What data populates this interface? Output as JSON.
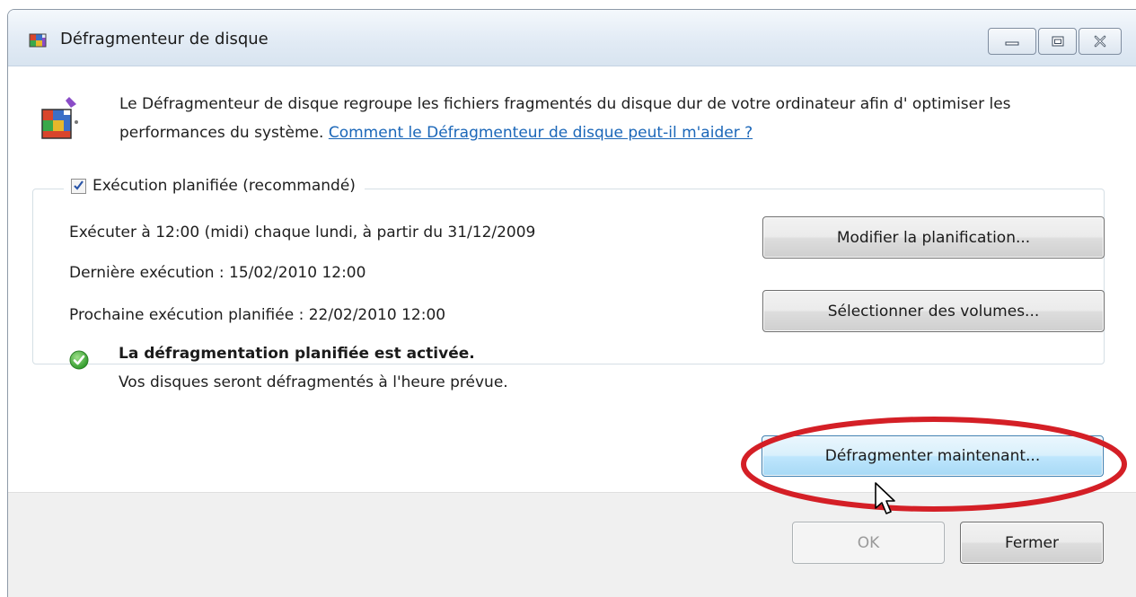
{
  "window": {
    "title": "Défragmenteur de disque",
    "controls": [
      "minimize",
      "maximize",
      "close"
    ]
  },
  "intro": {
    "text": "Le Défragmenteur de disque regroupe les fichiers fragmentés du disque dur de votre ordinateur afin d' optimiser les performances du système. ",
    "help_link": "Comment le Défragmenteur de disque peut-il m'aider ?"
  },
  "schedule": {
    "checkbox_label": "Exécution planifiée (recommandé)",
    "checked": true,
    "run_at": "Exécuter à 12:00 (midi) chaque lundi, à partir du 31/12/2009",
    "last_run": "Dernière exécution : 15/02/2010 12:00",
    "next_run": "Prochaine exécution planifiée : 22/02/2010 12:00",
    "modify_button": "Modifier la planification...",
    "select_volumes_button": "Sélectionner des volumes..."
  },
  "status": {
    "title": "La défragmentation planifiée est activée.",
    "subtitle": "Vos disques seront défragmentés à l'heure prévue.",
    "icon": "green-check-icon"
  },
  "actions": {
    "defrag_now_button": "Défragmenter maintenant...",
    "ok_button": "OK",
    "close_button": "Fermer"
  },
  "annotation": {
    "highlight_color": "#d41f26"
  },
  "colors": {
    "link": "#1a66b8",
    "hot_button_border": "#3c7fb1"
  }
}
